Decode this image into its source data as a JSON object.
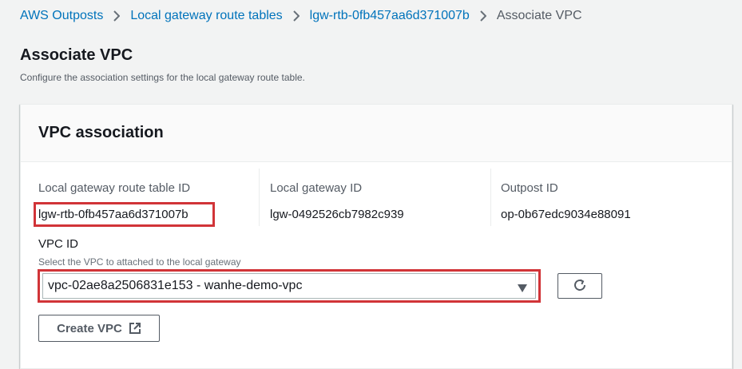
{
  "breadcrumb": {
    "items": [
      {
        "label": "AWS Outposts"
      },
      {
        "label": "Local gateway route tables"
      },
      {
        "label": "lgw-rtb-0fb457aa6d371007b"
      }
    ],
    "current": "Associate VPC"
  },
  "page": {
    "title": "Associate VPC",
    "description": "Configure the association settings for the local gateway route table."
  },
  "panel": {
    "title": "VPC association",
    "fields": {
      "route_table_id": {
        "label": "Local gateway route table ID",
        "value": "lgw-rtb-0fb457aa6d371007b"
      },
      "local_gateway_id": {
        "label": "Local gateway ID",
        "value": "lgw-0492526cb7982c939"
      },
      "outpost_id": {
        "label": "Outpost ID",
        "value": "op-0b67edc9034e88091"
      }
    },
    "vpc": {
      "label": "VPC ID",
      "description": "Select the VPC to attached to the local gateway",
      "selected": "vpc-02ae8a2506831e153 - wanhe-demo-vpc"
    },
    "create_vpc_label": "Create VPC"
  },
  "colors": {
    "link": "#0073bb",
    "highlight": "#d13438",
    "background": "#f2f3f3"
  },
  "icons": [
    "chevron-right-icon",
    "caret-down-icon",
    "refresh-icon",
    "external-link-icon"
  ]
}
